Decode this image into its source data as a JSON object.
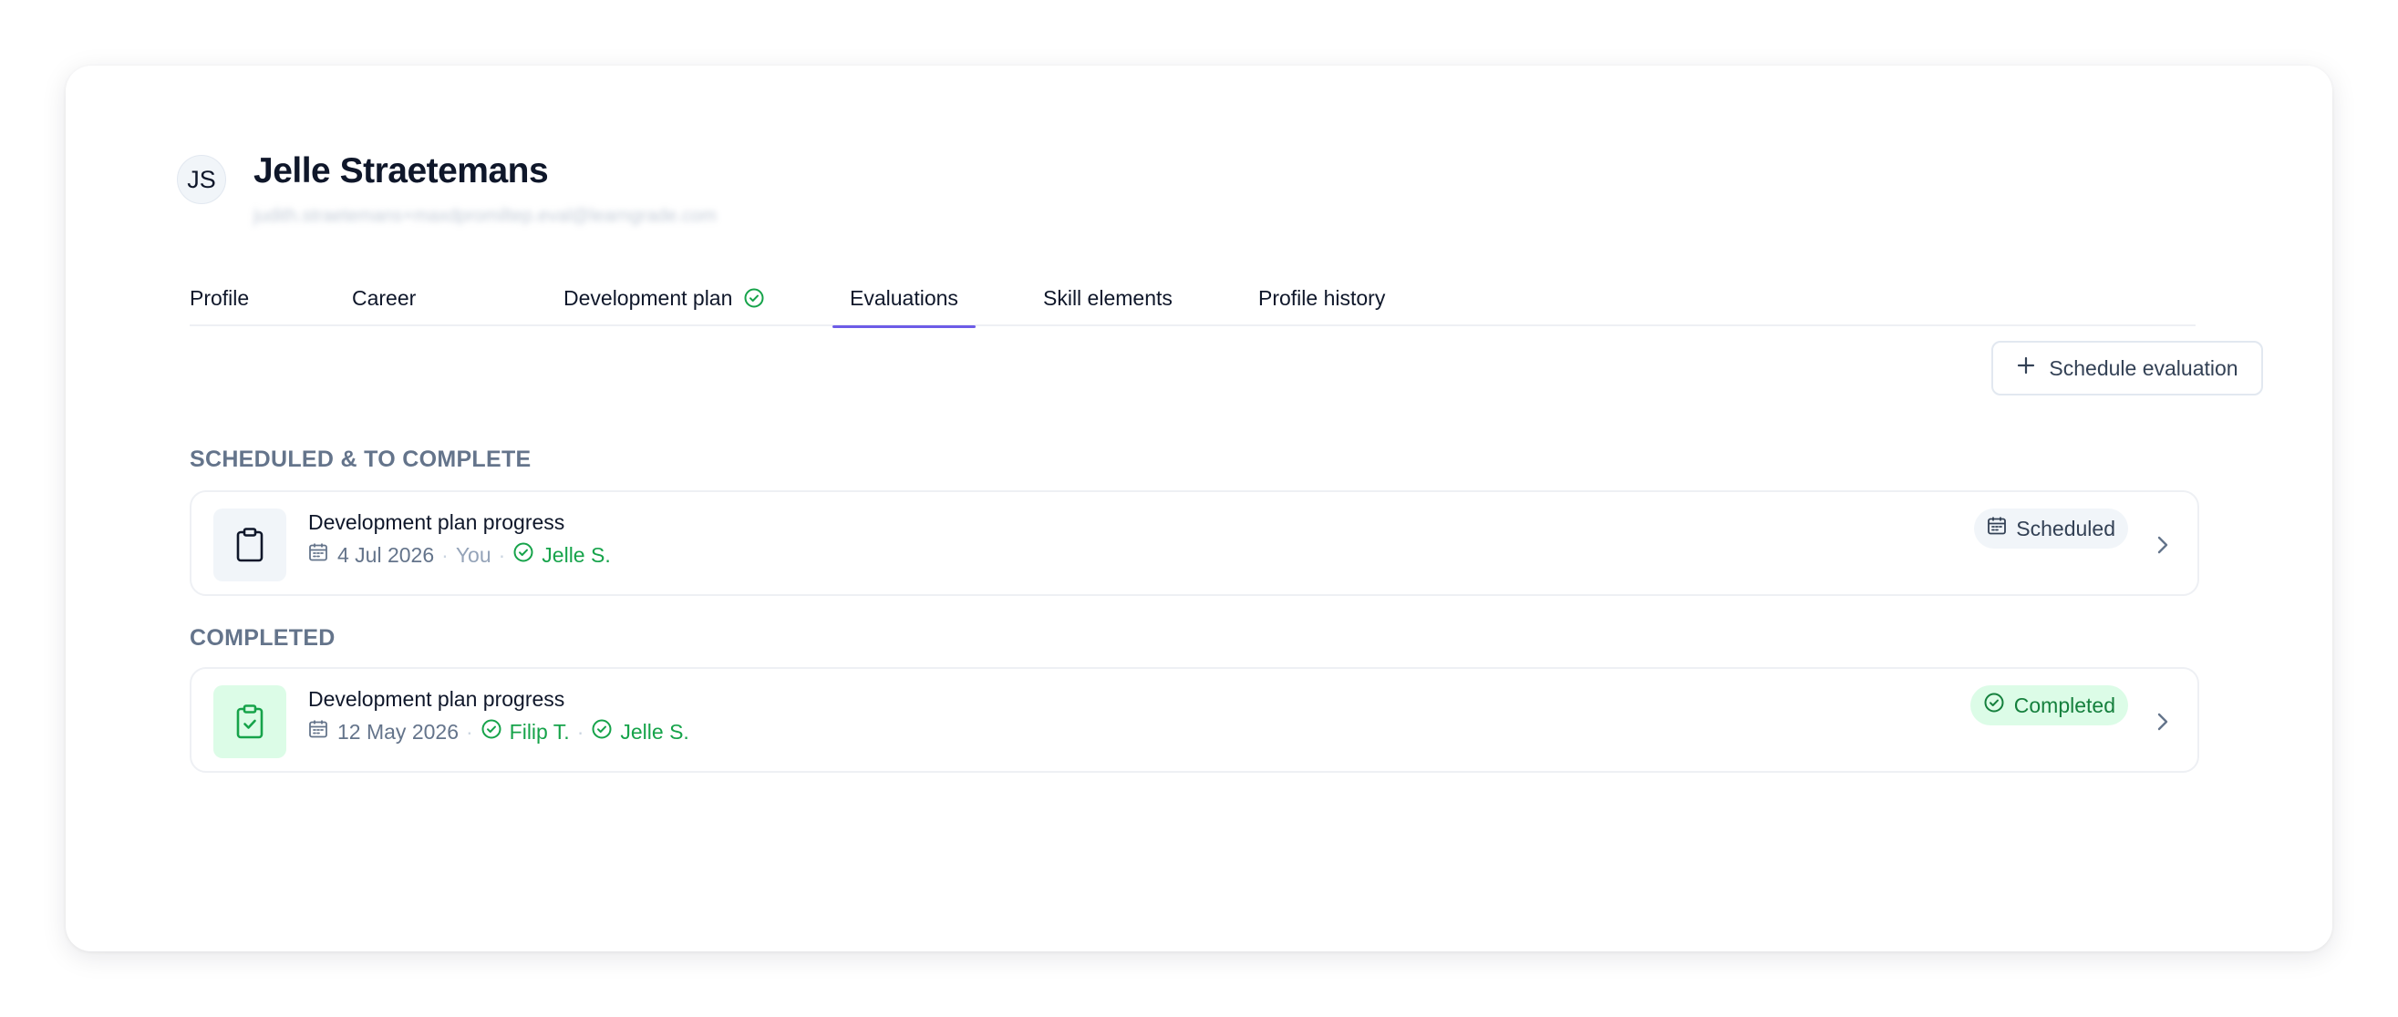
{
  "user": {
    "initials": "JS",
    "name": "Jelle Straetemans",
    "email": "judith.straetemans+maxdpromiltep.eval@learngrade.com"
  },
  "tabs": [
    {
      "label": "Profile",
      "active": false
    },
    {
      "label": "Career",
      "active": false
    },
    {
      "label": "Development plan",
      "active": false,
      "icon": "check-circle-icon"
    },
    {
      "label": "Evaluations",
      "active": true
    },
    {
      "label": "Skill elements",
      "active": false
    },
    {
      "label": "Profile history",
      "active": false
    }
  ],
  "actions": {
    "schedule_label": "Schedule evaluation"
  },
  "sections": {
    "scheduled": {
      "title": "SCHEDULED & TO COMPLETE",
      "items": [
        {
          "title": "Development plan progress",
          "date": "4 Jul 2026",
          "evaluator": "You",
          "participant": "Jelle S.",
          "status": "Scheduled",
          "icon": "clipboard-icon"
        }
      ]
    },
    "completed": {
      "title": "COMPLETED",
      "items": [
        {
          "title": "Development plan progress",
          "date": "12 May 2026",
          "evaluator": "Filip T.",
          "participant": "Jelle S.",
          "status": "Completed",
          "icon": "clipboard-check-icon"
        }
      ]
    }
  },
  "colors": {
    "accent": "#6d5ce7",
    "success": "#16a34a",
    "success_bg": "#dcfce7",
    "muted": "#64748b"
  }
}
